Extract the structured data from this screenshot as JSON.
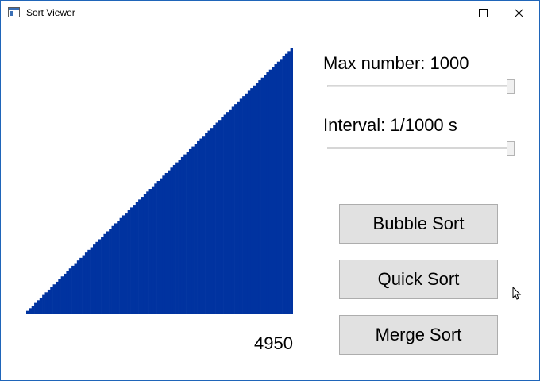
{
  "window": {
    "title": "Sort Viewer",
    "app_icon": "window-app-icon"
  },
  "titlebar": {
    "minimize_icon": "minimize-icon",
    "maximize_icon": "maximize-icon",
    "close_icon": "close-icon"
  },
  "controls": {
    "max_number_label": "Max number: 1000",
    "max_number_slider_value": 1.0,
    "interval_label": "Interval: 1/1000 s",
    "interval_slider_value": 1.0
  },
  "buttons": {
    "bubble": "Bubble Sort",
    "quick": "Quick Sort",
    "merge": "Merge Sort"
  },
  "visualization": {
    "bar_count": 100,
    "bar_color": "#0033a0",
    "values": [
      1,
      2,
      3,
      4,
      5,
      6,
      7,
      8,
      9,
      10,
      11,
      12,
      13,
      14,
      15,
      16,
      17,
      18,
      19,
      20,
      21,
      22,
      23,
      24,
      25,
      26,
      27,
      28,
      29,
      30,
      31,
      32,
      33,
      34,
      35,
      36,
      37,
      38,
      39,
      40,
      41,
      42,
      43,
      44,
      45,
      46,
      47,
      48,
      49,
      50,
      51,
      52,
      53,
      54,
      55,
      56,
      57,
      58,
      59,
      60,
      61,
      62,
      63,
      64,
      65,
      66,
      67,
      68,
      69,
      70,
      71,
      72,
      73,
      74,
      75,
      76,
      77,
      78,
      79,
      80,
      81,
      82,
      83,
      84,
      85,
      86,
      87,
      88,
      89,
      90,
      91,
      92,
      93,
      94,
      95,
      96,
      97,
      98,
      99,
      100
    ],
    "counter": "4950"
  }
}
